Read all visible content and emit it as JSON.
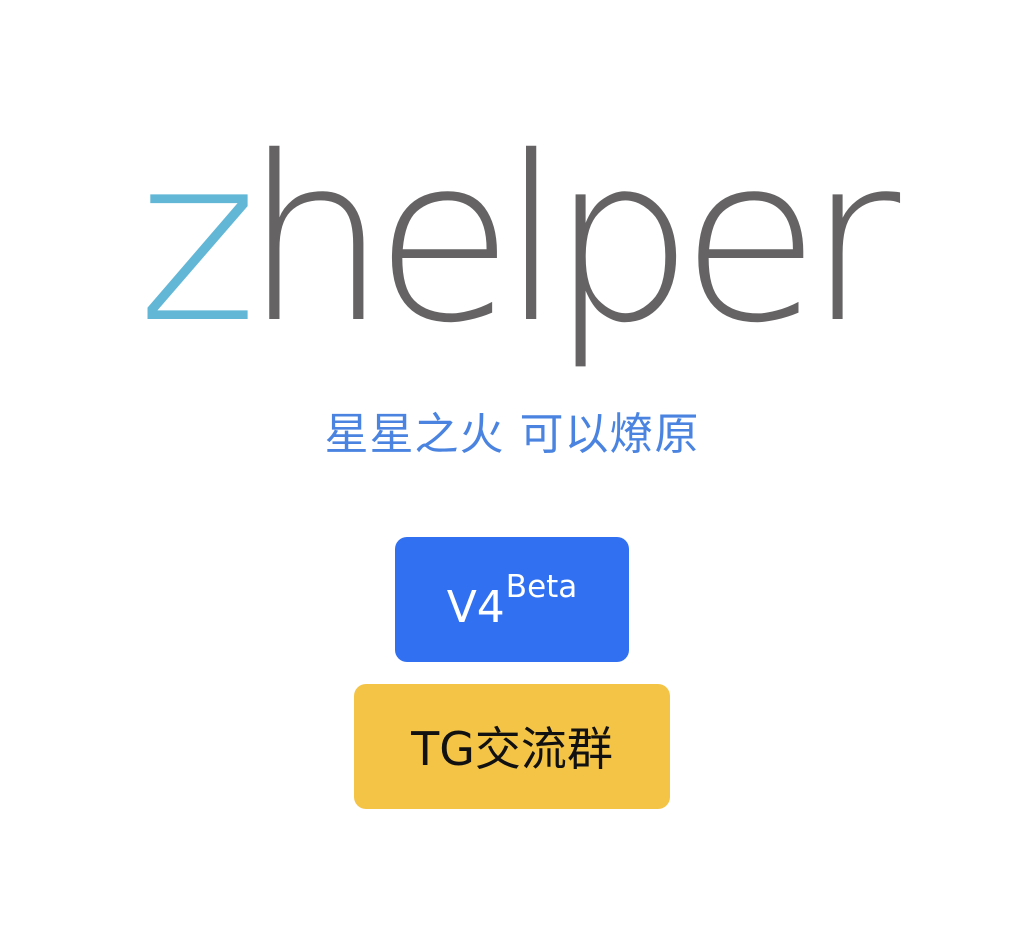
{
  "logo": {
    "z": "z",
    "rest": "helper"
  },
  "slogan": "星星之火 可以燎原",
  "buttons": {
    "v4": {
      "main": "V4",
      "sup": "Beta"
    },
    "tg": {
      "label": "TG交流群"
    }
  },
  "colors": {
    "logo_z": "#62b6d6",
    "logo_rest": "#656363",
    "slogan": "#4a84e0",
    "btn_v4_bg": "#3170f0",
    "btn_v4_fg": "#ffffff",
    "btn_tg_bg": "#f4c447",
    "btn_tg_fg": "#111111"
  }
}
